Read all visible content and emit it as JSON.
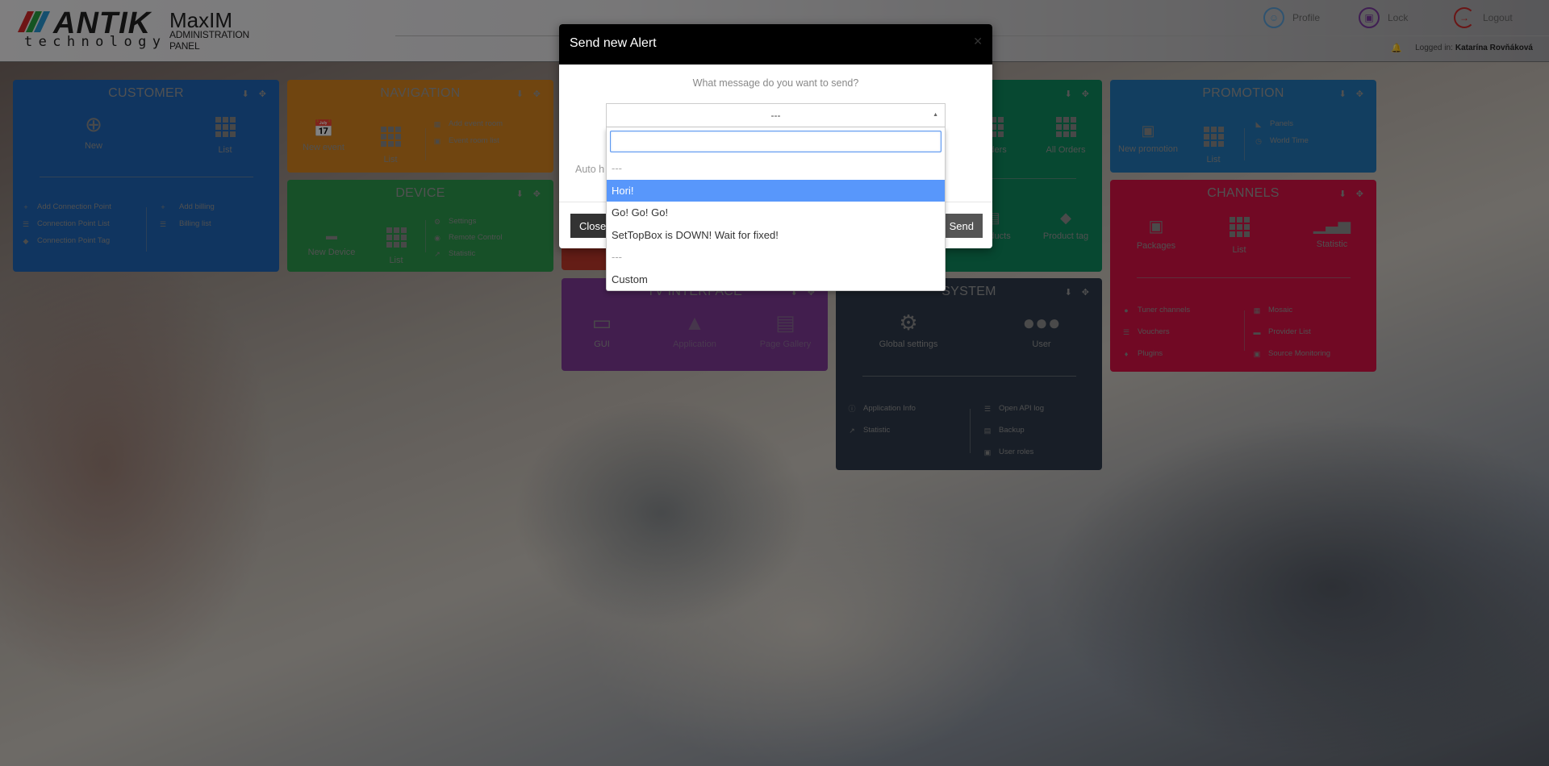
{
  "header": {
    "logo_brand": "ANTIK",
    "logo_sub": "technology",
    "app_name": "MaxIM",
    "app_subtitle": "ADMINISTRATION PANEL",
    "stripe_colors": [
      "#d42a2a",
      "#2aa142",
      "#2a97d4"
    ],
    "actions": [
      {
        "label": "Profile",
        "icon": "user-circle-icon",
        "color": "#5aa0d6"
      },
      {
        "label": "Lock",
        "icon": "lock-icon",
        "color": "#7b3aa0"
      },
      {
        "label": "Logout",
        "icon": "logout-icon",
        "color": "#cc2a2a"
      }
    ],
    "logged_in_label": "Logged in:",
    "logged_in_user": "Katarína Rovňáková"
  },
  "panels": {
    "customer": {
      "title": "CUSTOMER",
      "color": "#1f66b8",
      "big": [
        {
          "label": "New",
          "icon": "plus-circle-icon"
        },
        {
          "label": "List",
          "icon": "grid-icon"
        }
      ],
      "left_links": [
        {
          "label": "Add Connection Point",
          "icon": "plus-icon"
        },
        {
          "label": "Connection Point List",
          "icon": "list-icon"
        },
        {
          "label": "Connection Point Tag",
          "icon": "tag-icon"
        }
      ],
      "right_links": [
        {
          "label": "Add billing",
          "icon": "plus-icon"
        },
        {
          "label": "Billing list",
          "icon": "list-icon"
        }
      ]
    },
    "navigation": {
      "title": "NAVIGATION",
      "color": "#d7851f",
      "big": [
        {
          "label": "New event",
          "icon": "calendar-icon"
        },
        {
          "label": "List",
          "icon": "grid-icon"
        }
      ],
      "links": [
        {
          "label": "Add event room",
          "icon": "calendar-add-icon"
        },
        {
          "label": "Event room list",
          "icon": "inbox-icon"
        }
      ]
    },
    "device": {
      "title": "DEVICE",
      "color": "#2c9a4d",
      "big": [
        {
          "label": "New Device",
          "icon": "device-icon"
        },
        {
          "label": "List",
          "icon": "grid-icon"
        }
      ],
      "links": [
        {
          "label": "Settings",
          "icon": "cogs-icon"
        },
        {
          "label": "Remote Control",
          "icon": "gamepad-icon"
        },
        {
          "label": "Statistic",
          "icon": "chart-line-icon"
        }
      ]
    },
    "orders": {
      "title": "",
      "color": "#0f8a5f",
      "big": [
        {
          "label": "Orders",
          "icon": "grid-icon"
        },
        {
          "label": "All Orders",
          "icon": "grid-icon"
        }
      ],
      "big2": [
        {
          "label": "Products",
          "icon": "hdd-icon"
        },
        {
          "label": "Product tag",
          "icon": "tag-icon"
        }
      ]
    },
    "promotion": {
      "title": "PROMOTION",
      "color": "#2478b8",
      "big": [
        {
          "label": "New promotion",
          "icon": "image-icon"
        },
        {
          "label": "List",
          "icon": "grid-icon"
        }
      ],
      "links": [
        {
          "label": "Panels",
          "icon": "panels-icon"
        },
        {
          "label": "World Time",
          "icon": "clock-icon"
        }
      ]
    },
    "channels": {
      "title": "CHANNELS",
      "color": "#d81246",
      "big": [
        {
          "label": "Packages",
          "icon": "inbox-icon"
        },
        {
          "label": "List",
          "icon": "grid-icon"
        },
        {
          "label": "Statistic",
          "icon": "bar-chart-icon"
        }
      ],
      "left_links": [
        {
          "label": "Tuner channels",
          "icon": "globe-icon"
        },
        {
          "label": "Vouchers",
          "icon": "list-icon"
        },
        {
          "label": "Plugins",
          "icon": "puzzle-icon"
        }
      ],
      "right_links": [
        {
          "label": "Mosaic",
          "icon": "mosaic-icon"
        },
        {
          "label": "Provider List",
          "icon": "provider-icon"
        },
        {
          "label": "Source Monitoring",
          "icon": "monitor-icon"
        }
      ]
    },
    "tv_interface": {
      "title": "TV INTERFACE",
      "color": "#7f3a96",
      "big": [
        {
          "label": "GUI",
          "icon": "monitor-icon"
        },
        {
          "label": "Application",
          "icon": "road-icon"
        },
        {
          "label": "Page Gallery",
          "icon": "newspaper-icon"
        }
      ]
    },
    "system": {
      "title": "SYSTEM",
      "color": "#2f3b4c",
      "big": [
        {
          "label": "Global settings",
          "icon": "cogs-icon"
        },
        {
          "label": "User",
          "icon": "users-icon"
        }
      ],
      "left_links": [
        {
          "label": "Application Info",
          "icon": "info-icon"
        },
        {
          "label": "Statistic",
          "icon": "chart-line-icon"
        }
      ],
      "right_links": [
        {
          "label": "Open API log",
          "icon": "list-icon"
        },
        {
          "label": "Backup",
          "icon": "database-icon"
        },
        {
          "label": "User roles",
          "icon": "lock-icon"
        }
      ]
    },
    "hidden_red": {
      "color": "#c0392b"
    }
  },
  "modal": {
    "title": "Send new Alert",
    "question": "What message do you want to send?",
    "select_value": "---",
    "auto_label": "Auto h",
    "search_value": "",
    "options": [
      {
        "label": "---",
        "type": "separator"
      },
      {
        "label": "Hori!",
        "type": "option",
        "highlighted": true
      },
      {
        "label": "Go! Go! Go!",
        "type": "option"
      },
      {
        "label": "SetTopBox is DOWN! Wait for fixed!",
        "type": "option"
      },
      {
        "label": "---",
        "type": "separator"
      },
      {
        "label": "Custom",
        "type": "option"
      }
    ],
    "close_label": "Close",
    "send_label": "Send"
  }
}
